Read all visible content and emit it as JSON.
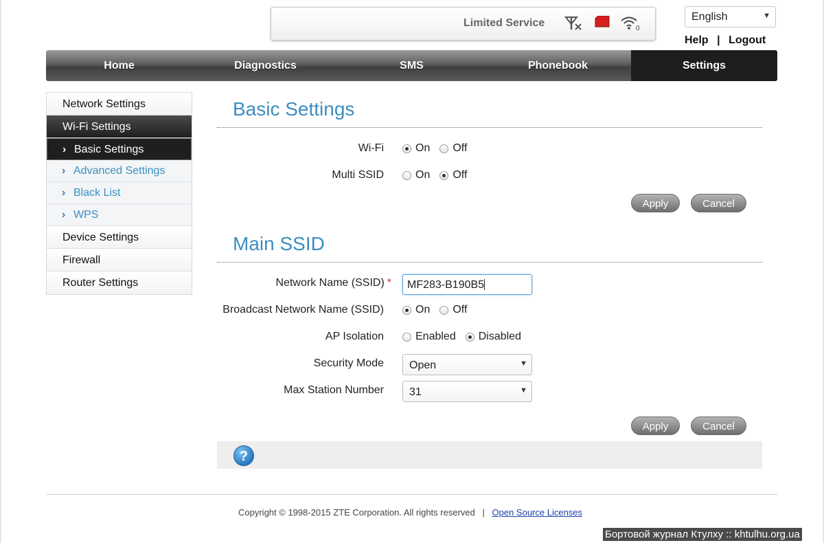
{
  "status": {
    "text": "Limited Service",
    "icons": [
      "signal-none-icon",
      "sim-card-icon",
      "wifi-icon"
    ],
    "wifi_clients": "0"
  },
  "language": {
    "selected": "English"
  },
  "top_links": {
    "help": "Help",
    "separator": "|",
    "logout": "Logout"
  },
  "nav": {
    "tabs": [
      {
        "label": "Home"
      },
      {
        "label": "Diagnostics"
      },
      {
        "label": "SMS"
      },
      {
        "label": "Phonebook"
      },
      {
        "label": "Settings"
      }
    ],
    "active": "Settings"
  },
  "sidebar": {
    "items": [
      {
        "label": "Network Settings"
      },
      {
        "label": "Wi-Fi Settings"
      },
      {
        "label": "Basic Settings"
      },
      {
        "label": "Advanced Settings"
      },
      {
        "label": "Black List"
      },
      {
        "label": "WPS"
      },
      {
        "label": "Device Settings"
      },
      {
        "label": "Firewall"
      },
      {
        "label": "Router Settings"
      }
    ]
  },
  "basic": {
    "title": "Basic Settings",
    "wifi": {
      "label": "Wi-Fi",
      "on": "On",
      "off": "Off",
      "selected": "On"
    },
    "multi_ssid": {
      "label": "Multi SSID",
      "on": "On",
      "off": "Off",
      "selected": "Off"
    },
    "apply": "Apply",
    "cancel": "Cancel"
  },
  "main_ssid": {
    "title": "Main SSID",
    "network_name": {
      "label": "Network Name (SSID)",
      "required_mark": "*",
      "value": "MF283-B190B5"
    },
    "broadcast": {
      "label": "Broadcast Network Name (SSID)",
      "on": "On",
      "off": "Off",
      "selected": "On"
    },
    "ap_isolation": {
      "label": "AP Isolation",
      "enabled": "Enabled",
      "disabled": "Disabled",
      "selected": "Disabled"
    },
    "security_mode": {
      "label": "Security Mode",
      "value": "Open"
    },
    "max_station": {
      "label": "Max Station Number",
      "value": "31"
    },
    "apply": "Apply",
    "cancel": "Cancel"
  },
  "help": {
    "symbol": "?"
  },
  "footer": {
    "copyright": "Copyright © 1998-2015 ZTE Corporation. All rights reserved",
    "separator": "|",
    "link": "Open Source Licenses"
  },
  "watermark": "Бортовой журнал Ктулху :: khtulhu.org.ua",
  "colors": {
    "accent": "#3d8dc0",
    "nav_dark": "#1e1e1e",
    "required": "#d33333"
  }
}
